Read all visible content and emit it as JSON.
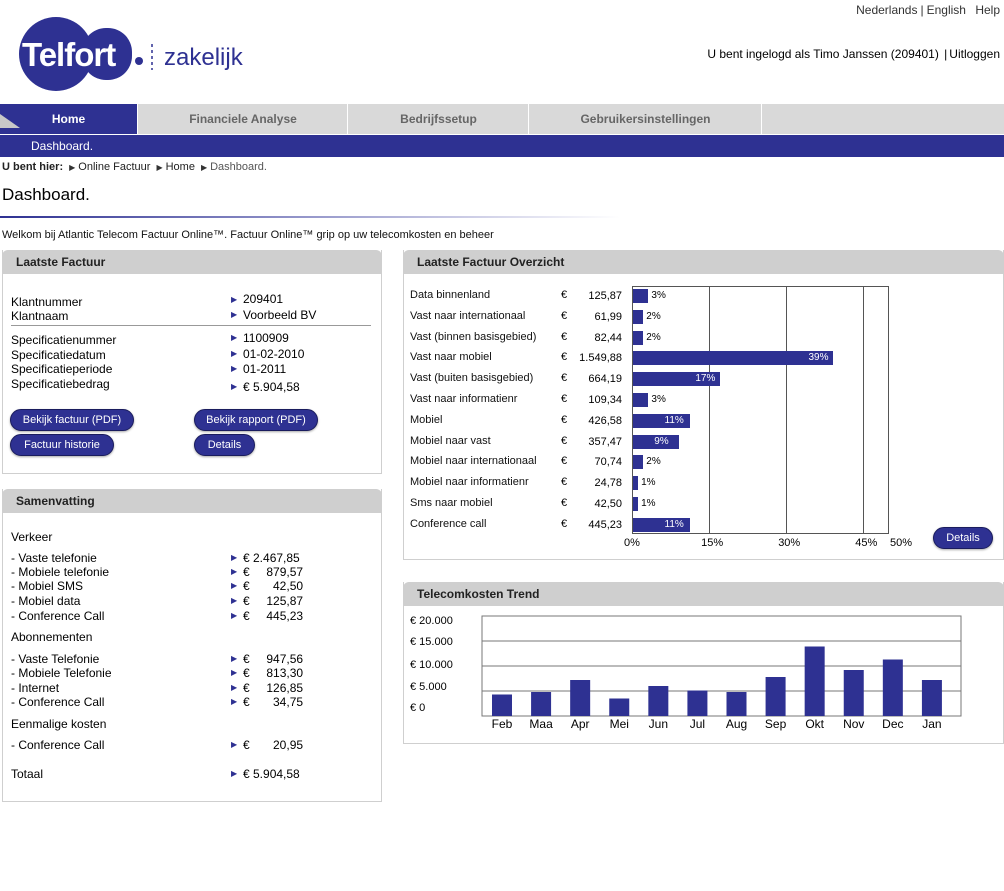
{
  "header": {
    "languages": [
      "Nederlands",
      "English"
    ],
    "help": "Help",
    "brand": "Telfort",
    "brand_sub": "zakelijk",
    "logged_in_text": "U bent ingelogd als Timo Janssen (209401)",
    "logout": "Uitloggen"
  },
  "nav": {
    "tabs": [
      {
        "label": "Home",
        "active": true
      },
      {
        "label": "Financiele Analyse",
        "active": false
      },
      {
        "label": "Bedrijfssetup",
        "active": false
      },
      {
        "label": "Gebruikersinstellingen",
        "active": false
      }
    ],
    "sub": "Dashboard."
  },
  "breadcrumb": {
    "prefix": "U bent hier:",
    "items": [
      "Online Factuur",
      "Home",
      "Dashboard."
    ]
  },
  "page": {
    "title": "Dashboard.",
    "welcome": "Welkom bij Atlantic Telecom Factuur Online™. Factuur Online™ grip op uw telecomkosten en beheer"
  },
  "laatste_factuur": {
    "title": "Laatste Factuur",
    "rows": [
      {
        "label": "Klantnummer",
        "value": "209401"
      },
      {
        "label": "Klantnaam",
        "value": "Voorbeeld BV"
      },
      {
        "label": "Specificatienummer",
        "value": "1100909"
      },
      {
        "label": "Specificatiedatum",
        "value": "01-02-2010"
      },
      {
        "label": "Specificatieperiode",
        "value": "01-2011"
      },
      {
        "label": "Specificatiebedrag",
        "value": "€ 5.904,58"
      }
    ],
    "buttons": {
      "bekijk_factuur": "Bekijk factuur (PDF)",
      "bekijk_rapport": "Bekijk rapport (PDF)",
      "factuur_historie": "Factuur historie",
      "details": "Details"
    }
  },
  "samenvatting": {
    "title": "Samenvatting",
    "verkeer_title": "Verkeer",
    "verkeer": [
      {
        "label": "- Vaste telefonie",
        "value": "€ 2.467,85"
      },
      {
        "label": "- Mobiele telefonie",
        "value": "€     879,57"
      },
      {
        "label": "- Mobiel SMS",
        "value": "€       42,50"
      },
      {
        "label": "- Mobiel data",
        "value": "€     125,87"
      },
      {
        "label": "- Conference Call",
        "value": "€     445,23"
      }
    ],
    "abonnementen_title": "Abonnementen",
    "abonnementen": [
      {
        "label": "- Vaste Telefonie",
        "value": "€     947,56"
      },
      {
        "label": "- Mobiele Telefonie",
        "value": "€     813,30"
      },
      {
        "label": "- Internet",
        "value": "€     126,85"
      },
      {
        "label": "- Conference Call",
        "value": "€       34,75"
      }
    ],
    "eenmalig_title": "Eenmalige kosten",
    "eenmalig": [
      {
        "label": "- Conference Call",
        "value": "€       20,95"
      }
    ],
    "totaal_label": "Totaal",
    "totaal_value": "€ 5.904,58"
  },
  "overzicht": {
    "title": "Laatste Factuur Overzicht",
    "details_button": "Details",
    "chart_data": {
      "type": "bar",
      "orientation": "horizontal",
      "currency": "€",
      "categories": [
        "Data binnenland",
        "Vast naar internationaal",
        "Vast (binnen basisgebied)",
        "Vast naar mobiel",
        "Vast (buiten basisgebied)",
        "Vast naar informatienr",
        "Mobiel",
        "Mobiel naar vast",
        "Mobiel naar internationaal",
        "Mobiel naar informatienr",
        "Sms naar mobiel",
        "Conference call"
      ],
      "amounts": [
        "125,87",
        "61,99",
        "82,44",
        "1.549,88",
        "664,19",
        "109,34",
        "426,58",
        "357,47",
        "70,74",
        "24,78",
        "42,50",
        "445,23"
      ],
      "values": [
        3,
        2,
        2,
        39,
        17,
        3,
        11,
        9,
        2,
        1,
        1,
        11
      ],
      "labels": [
        "3%",
        "2%",
        "2%",
        "39%",
        "17%",
        "3%",
        "11%",
        "9%",
        "2%",
        "1%",
        "1%",
        "11%"
      ],
      "xticks": [
        "0%",
        "15%",
        "30%",
        "45%",
        "50%"
      ],
      "xlim": [
        0,
        50
      ],
      "bar_color": "#2e3192"
    }
  },
  "trend": {
    "title": "Telecomkosten Trend",
    "chart_data": {
      "type": "bar",
      "categories": [
        "Feb",
        "Maa",
        "Apr",
        "Mei",
        "Jun",
        "Jul",
        "Aug",
        "Sep",
        "Okt",
        "Nov",
        "Dec",
        "Jan"
      ],
      "values": [
        4300,
        4800,
        7200,
        3500,
        6000,
        5100,
        4800,
        7800,
        13900,
        9200,
        11300,
        7200
      ],
      "yticks": [
        "€ 20.000",
        "€ 15.000",
        "€ 10.000",
        "€  5.000",
        "€          0"
      ],
      "ylim": [
        0,
        20000
      ],
      "bar_color": "#2e3192"
    }
  },
  "colors": {
    "brand": "#2e3192",
    "panel_header": "#cfcfcf",
    "nav_bg": "#d9d9d9"
  }
}
